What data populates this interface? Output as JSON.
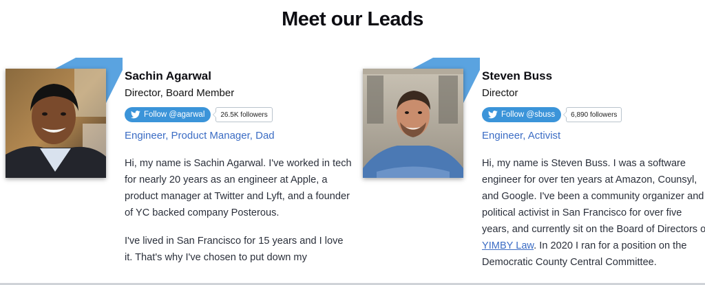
{
  "page": {
    "title": "Meet our Leads"
  },
  "colors": {
    "accent_blue": "#5aa3e0",
    "twitter_blue": "#3b94d9",
    "link_blue": "#3b6cc4"
  },
  "leads": [
    {
      "name": "Sachin Agarwal",
      "role": "Director, Board Member",
      "follow_label": "Follow @agarwal",
      "followers": "26.5K followers",
      "tagline": "Engineer, Product Manager, Dad",
      "bio_1": "Hi, my name is Sachin Agarwal. I've worked in tech for nearly 20 years as an engineer at Apple, a product manager at Twitter and Lyft, and a founder of YC backed company Posterous.",
      "bio_2": "I've lived in San Francisco for 15 years and I love it. That's why I've chosen to put down my",
      "photo_icon": "portrait-photo"
    },
    {
      "name": "Steven Buss",
      "role": "Director",
      "follow_label": "Follow @sbuss",
      "followers": "6,890 followers",
      "tagline": "Engineer, Activist",
      "bio_before_link": "Hi, my name is Steven Buss. I was a software engineer for over ten years at Amazon, Counsyl, and Google. I've been a community organizer and political activist in San Francisco for over five years, and currently sit on the Board of Directors of ",
      "bio_link": "YIMBY Law",
      "bio_after_link": ". In 2020 I ran for a position on the Democratic County Central Committee.",
      "photo_icon": "portrait-photo"
    }
  ]
}
